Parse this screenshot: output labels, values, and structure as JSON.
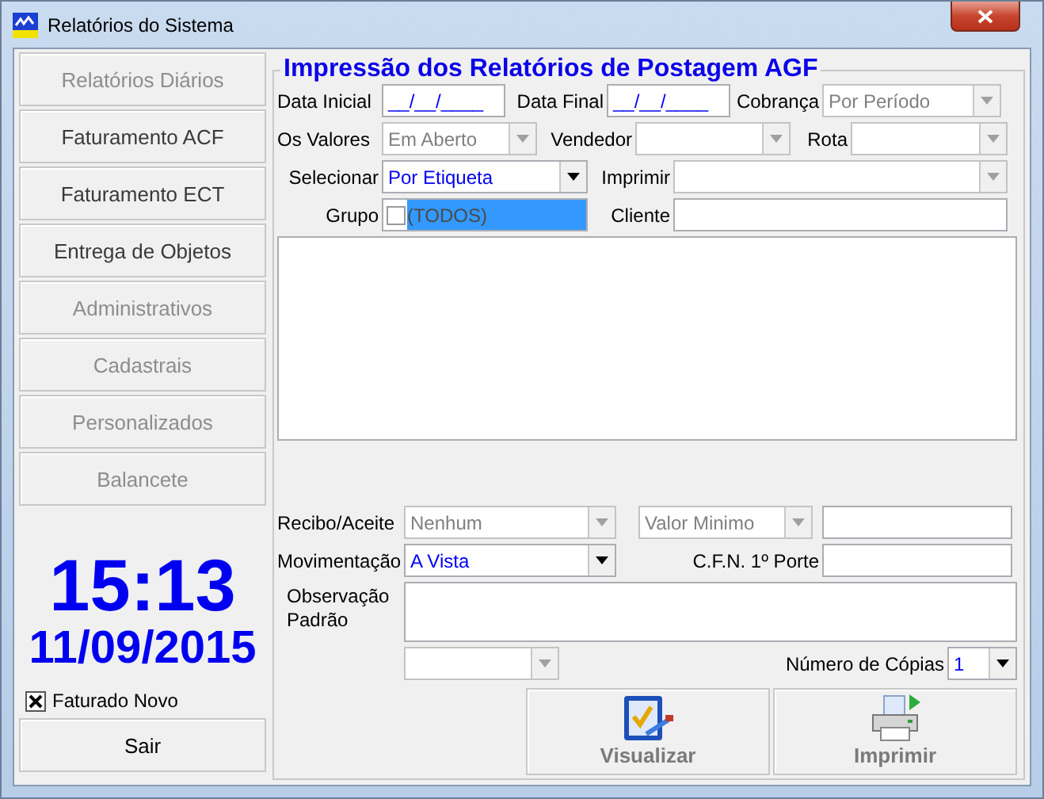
{
  "window": {
    "title": "Relatórios do Sistema"
  },
  "menu": [
    {
      "label": "Relatórios Diários",
      "disabled": true
    },
    {
      "label": "Faturamento ACF",
      "disabled": false
    },
    {
      "label": "Faturamento ECT",
      "disabled": false
    },
    {
      "label": "Entrega de Objetos",
      "disabled": false
    },
    {
      "label": "Administrativos",
      "disabled": true
    },
    {
      "label": "Cadastrais",
      "disabled": true
    },
    {
      "label": "Personalizados",
      "disabled": true
    },
    {
      "label": "Balancete",
      "disabled": true
    }
  ],
  "clock": {
    "time": "15:13",
    "date": "11/09/2015"
  },
  "faturado_novo": {
    "label": "Faturado Novo",
    "checked": true
  },
  "exit_button": {
    "label": "Sair"
  },
  "form": {
    "title": "Impressão dos Relatórios de Postagem AGF",
    "data_inicial": {
      "label": "Data Inicial",
      "value": "__/__/____"
    },
    "data_final": {
      "label": "Data Final",
      "value": "__/__/____"
    },
    "cobranca": {
      "label": "Cobrança",
      "value": "Por Período",
      "disabled": true
    },
    "os_valores": {
      "label": "Os Valores",
      "value": "Em Aberto",
      "disabled": true
    },
    "vendedor": {
      "label": "Vendedor",
      "disabled": true
    },
    "rota": {
      "label": "Rota",
      "disabled": true
    },
    "selecionar": {
      "label": "Selecionar",
      "value": "Por Etiqueta",
      "disabled": false
    },
    "imprimir": {
      "label": "Imprimir",
      "disabled": true
    },
    "grupo": {
      "label": "Grupo",
      "value": "(TODOS)",
      "checked": false,
      "selected": true
    },
    "cliente": {
      "label": "Cliente"
    },
    "recibo": {
      "label": "Recibo/Aceite",
      "value": "Nenhum",
      "disabled": true
    },
    "valor_minimo": {
      "value": "Valor Minimo",
      "disabled": true
    },
    "movimentacao": {
      "label": "Movimentação",
      "value": "A Vista",
      "disabled": false
    },
    "cfn": {
      "label": "C.F.N. 1º Porte"
    },
    "observacao": {
      "label": "Observação Padrão"
    },
    "extra_combo": {
      "disabled": true
    },
    "copias": {
      "label": "Número de Cópias",
      "value": "1",
      "disabled": false
    },
    "actions": [
      {
        "label": "Visualizar",
        "kind": "preview",
        "disabled": true
      },
      {
        "label": "Imprimir",
        "kind": "print",
        "disabled": true
      }
    ]
  }
}
